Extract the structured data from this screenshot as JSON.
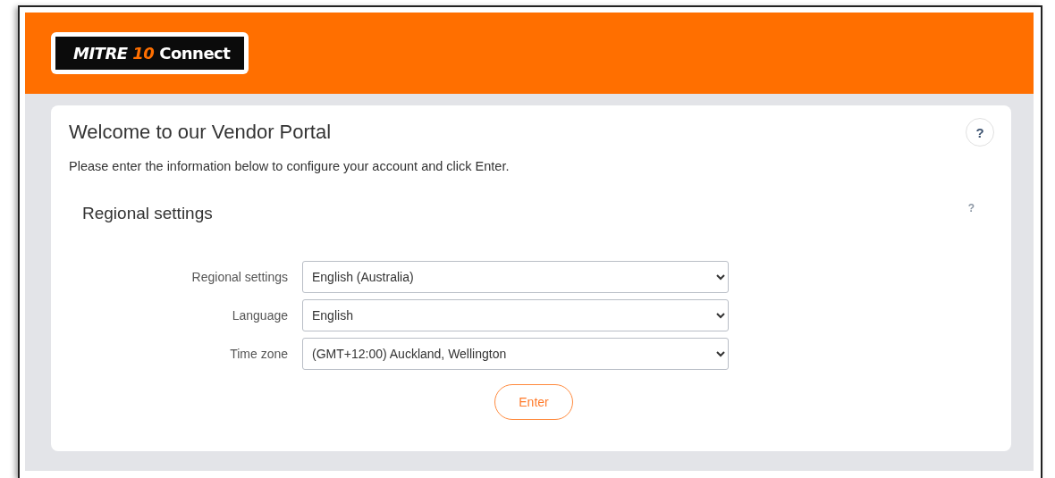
{
  "header": {
    "logo": {
      "brand": "MITRE",
      "number": "10",
      "product": "Connect"
    }
  },
  "card": {
    "title": "Welcome to our Vendor Portal",
    "help": "?",
    "intro": "Please enter the information below to configure your account and click Enter.",
    "section": {
      "title": "Regional settings",
      "help": "?",
      "fields": [
        {
          "label": "Regional settings",
          "value": "English (Australia)"
        },
        {
          "label": "Language",
          "value": "English"
        },
        {
          "label": "Time zone",
          "value": "(GMT+12:00) Auckland, Wellington"
        }
      ],
      "submit": "Enter"
    }
  }
}
